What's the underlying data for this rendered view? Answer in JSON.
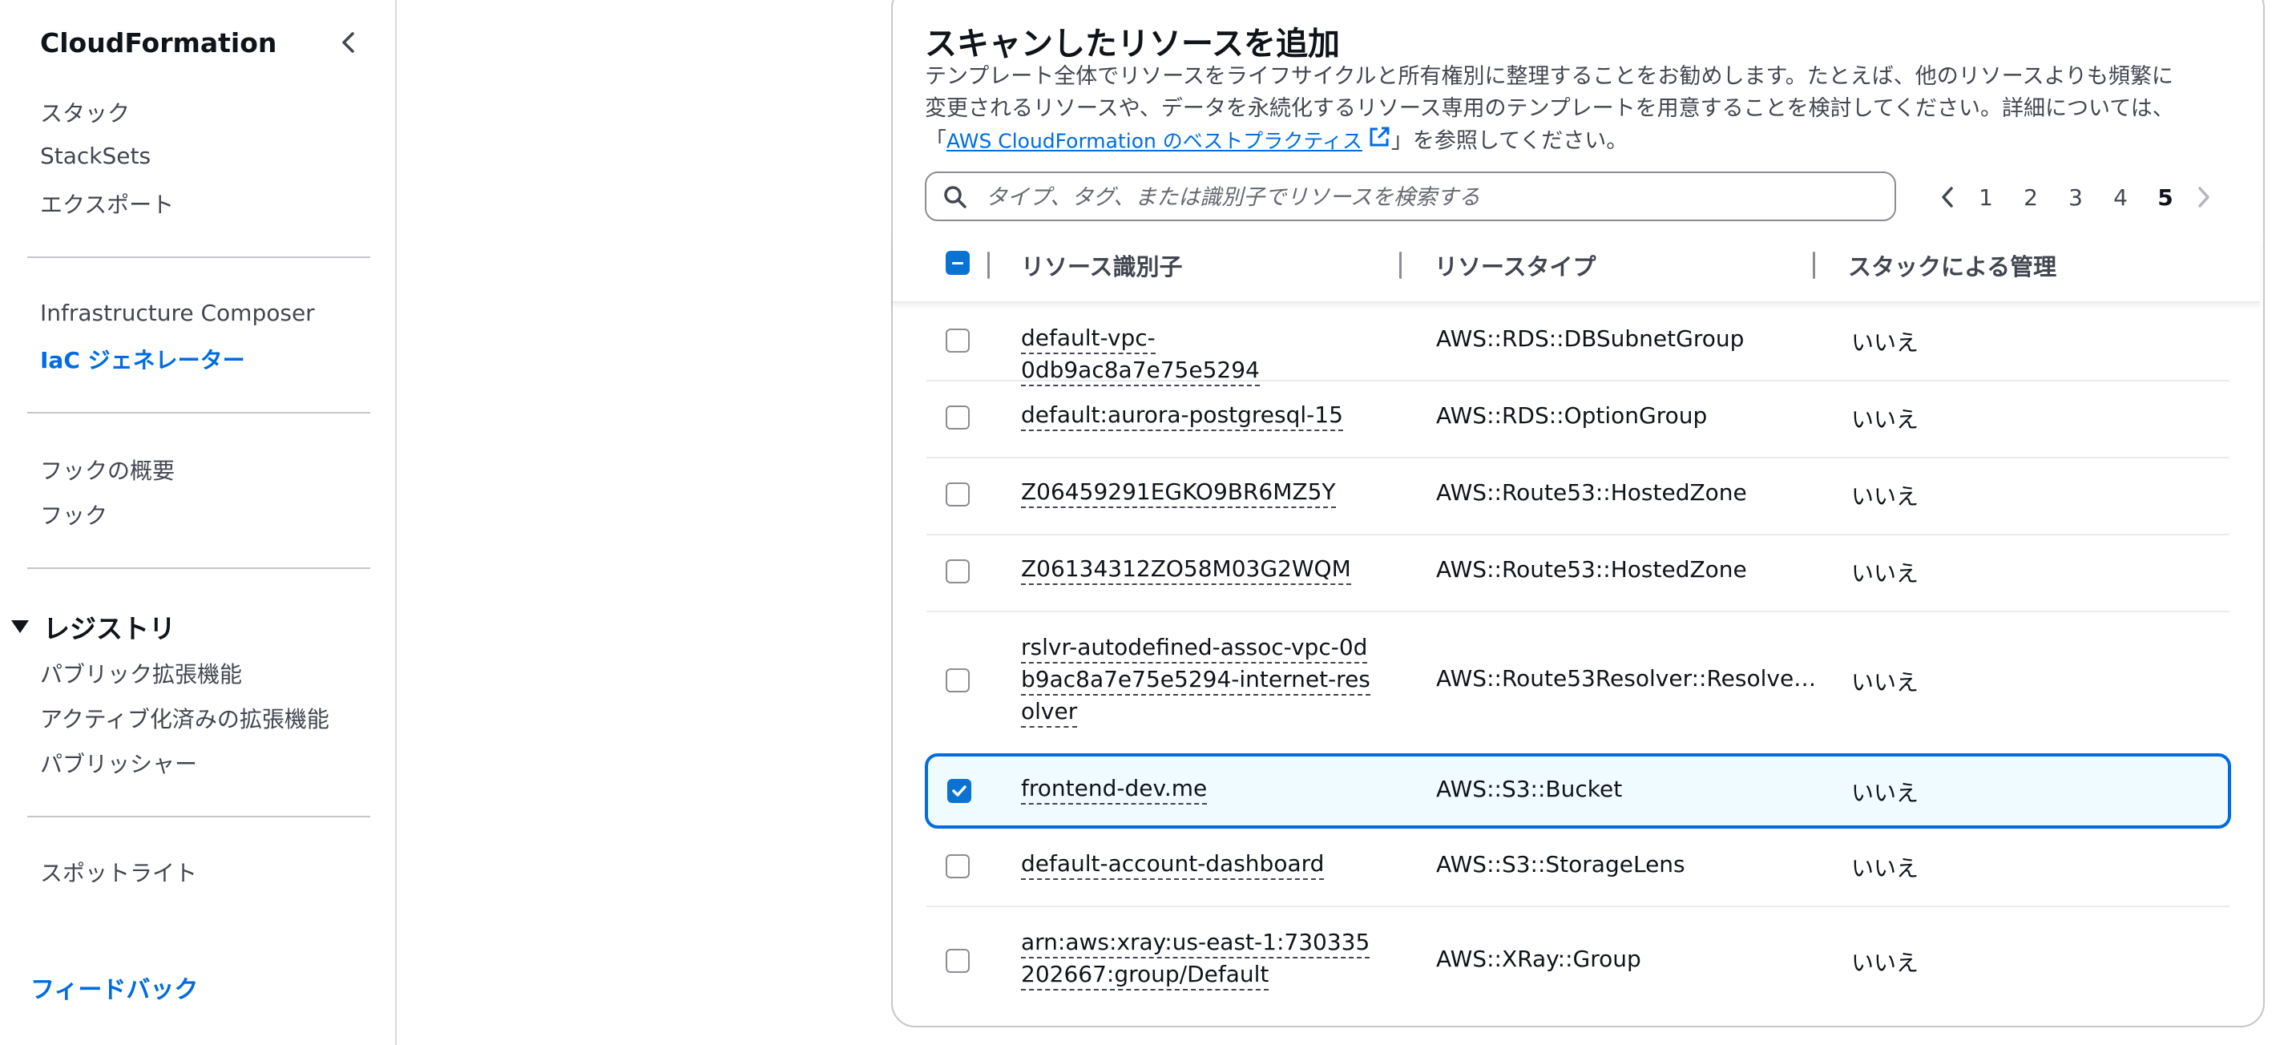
{
  "sidebar": {
    "title": "CloudFormation",
    "group1": [
      "スタック",
      "StackSets",
      "エクスポート"
    ],
    "group2": [
      "Infrastructure Composer",
      "IaC ジェネレーター"
    ],
    "group3": [
      "フックの概要",
      "フック"
    ],
    "registry": {
      "heading": "レジストリ",
      "items": [
        "パブリック拡張機能",
        "アクティブ化済みの拡張機能",
        "パブリッシャー"
      ]
    },
    "spotlight": "スポットライト",
    "feedback": "フィードバック"
  },
  "header": {
    "title": "スキャンしたリソースを追加",
    "desc_line1": "テンプレート全体でリソースをライフサイクルと所有権別に整理することをお勧めします。たとえば、他のリソースよりも頻繁に",
    "desc_line2": "変更されるリソースや、データを永続化するリソース専用のテンプレートを用意することを検討してください。詳細については、",
    "desc_prefix": "「",
    "desc_link": "AWS CloudFormation のベストプラクティス",
    "desc_suffix": "」を参照してください。"
  },
  "search": {
    "placeholder": "タイプ、タグ、または識別子でリソースを検索する"
  },
  "pagination": {
    "pages": [
      "1",
      "2",
      "3",
      "4",
      "5"
    ],
    "current": "5"
  },
  "table": {
    "columns": [
      "リソース識別子",
      "リソースタイプ",
      "スタックによる管理"
    ],
    "rows": [
      {
        "id": "default-vpc-0db9ac8a7e75e5294",
        "type": "AWS::RDS::DBSubnetGroup",
        "managed": "いいえ",
        "checked": false
      },
      {
        "id": "default:aurora-postgresql-15",
        "type": "AWS::RDS::OptionGroup",
        "managed": "いいえ",
        "checked": false
      },
      {
        "id": "Z06459291EGKO9BR6MZ5Y",
        "type": "AWS::Route53::HostedZone",
        "managed": "いいえ",
        "checked": false
      },
      {
        "id": "Z06134312ZO58M03G2WQM",
        "type": "AWS::Route53::HostedZone",
        "managed": "いいえ",
        "checked": false
      },
      {
        "id": "rslvr-autodefined-assoc-vpc-0db9ac8a7e75e5294-internet-resolver",
        "type": "AWS::Route53Resolver::Resolve…",
        "managed": "いいえ",
        "checked": false
      },
      {
        "id": "frontend-dev.me",
        "type": "AWS::S3::Bucket",
        "managed": "いいえ",
        "checked": true
      },
      {
        "id": "default-account-dashboard",
        "type": "AWS::S3::StorageLens",
        "managed": "いいえ",
        "checked": false
      },
      {
        "id": "arn:aws:xray:us-east-1:730335202667:group/Default",
        "type": "AWS::XRay::Group",
        "managed": "いいえ",
        "checked": false
      }
    ]
  },
  "colors": {
    "link": "#006ce0",
    "checkbox": "#0972d3",
    "selected_bg": "#f0fbff"
  }
}
